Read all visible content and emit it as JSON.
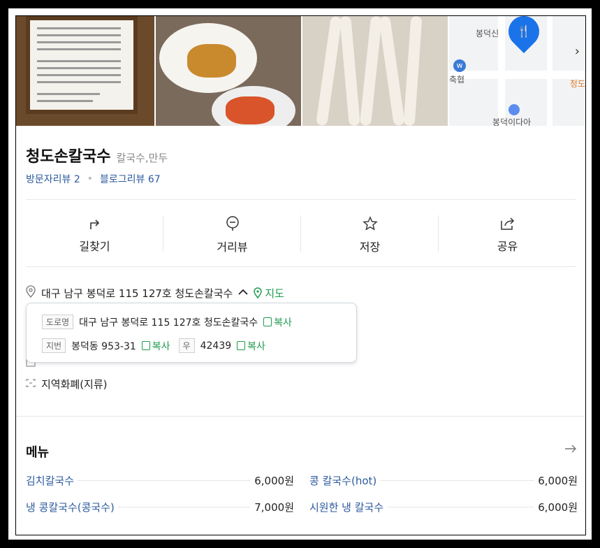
{
  "place": {
    "name": "청도손칼국수",
    "category": "칼국수,만두",
    "visitor_reviews": "방문자리뷰 2",
    "blog_reviews": "블로그리뷰 67"
  },
  "map": {
    "label_1": "봉덕신",
    "label_2": "축협",
    "label_3": "청도",
    "label_4": "봉덕이다아",
    "pin_icon": "fork-knife-icon"
  },
  "actions": [
    {
      "label": "길찾기",
      "icon": "directions-icon"
    },
    {
      "label": "거리뷰",
      "icon": "streetview-icon"
    },
    {
      "label": "저장",
      "icon": "star-icon"
    },
    {
      "label": "공유",
      "icon": "share-icon"
    }
  ],
  "address": {
    "summary": "대구 남구 봉덕로 115 127호 청도손칼국수",
    "map_link": "지도",
    "road_tag": "도로명",
    "road": "대구 남구 봉덕로 115 127호 청도손칼국수",
    "jibun_tag": "지번",
    "jibun": "봉덕동 953-31",
    "zip_tag": "우",
    "zip": "42439",
    "copy": "복사"
  },
  "currency": "지역화폐(지류)",
  "menu": {
    "title": "메뉴",
    "items": [
      {
        "name": "김치칼국수",
        "price": "6,000원"
      },
      {
        "name": "콩 칼국수(hot)",
        "price": "6,000원"
      },
      {
        "name": "냉 콩칼국수(콩국수)",
        "price": "7,000원"
      },
      {
        "name": "시원한 냉 칼국수",
        "price": "6,000원"
      }
    ]
  },
  "colors": {
    "link_blue": "#2c5a9e",
    "green": "#1d9b4e"
  }
}
